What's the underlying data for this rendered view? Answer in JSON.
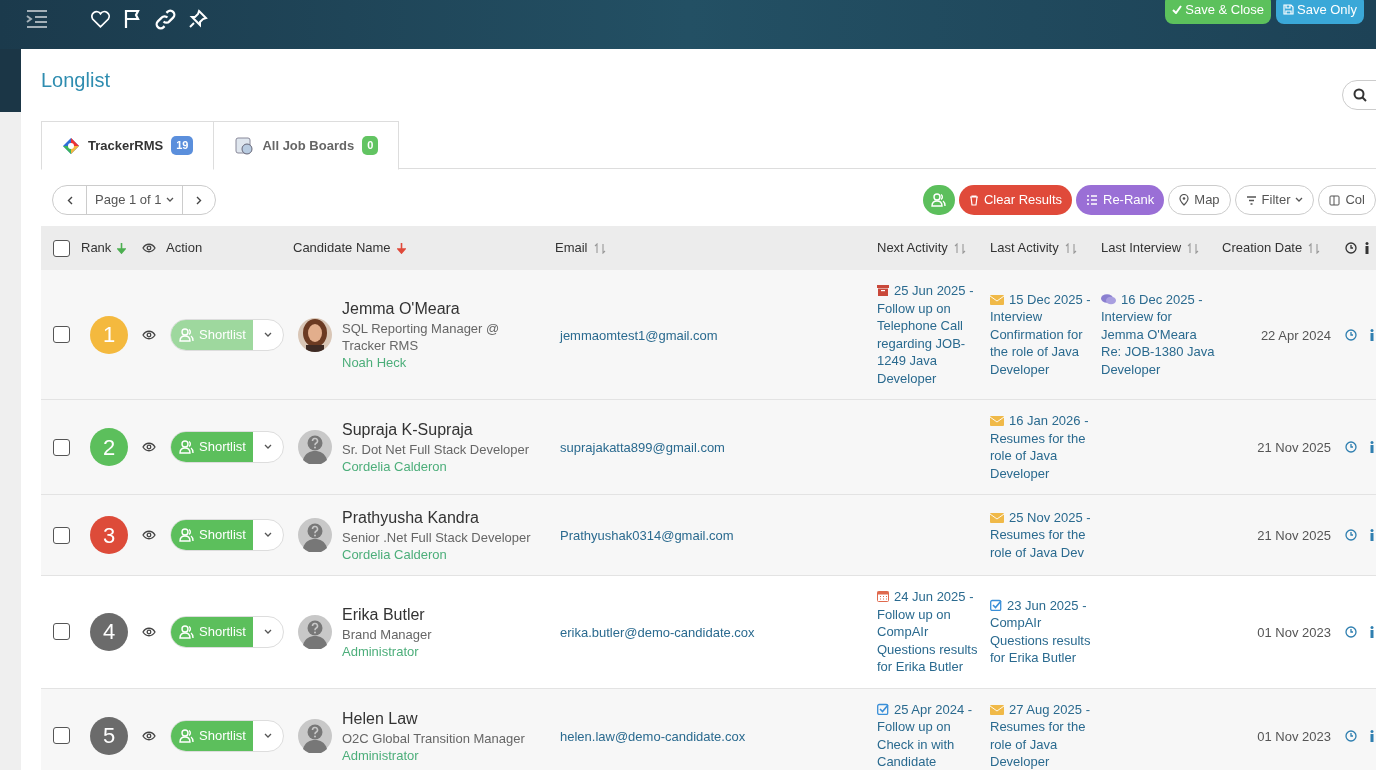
{
  "header": {
    "buttons": [
      {
        "kind": "save-close",
        "label": "Save & Close"
      },
      {
        "kind": "save",
        "label": "Save Only"
      }
    ]
  },
  "page_title": "Longlist",
  "tabs": [
    {
      "label": "TrackerRMS",
      "count": "19",
      "selected": true
    },
    {
      "label": "All Job Boards",
      "count": "0",
      "selected": false
    }
  ],
  "pager": {
    "label": "Page 1 of 1"
  },
  "actions": [
    {
      "kind": "shortlist"
    },
    {
      "kind": "clear",
      "label": "Clear Results"
    },
    {
      "kind": "rerank",
      "label": "Re-Rank"
    },
    {
      "kind": "map",
      "label": "Map"
    },
    {
      "kind": "filter",
      "label": "Filter"
    },
    {
      "kind": "columns",
      "label": "Col"
    }
  ],
  "columns": [
    {
      "kind": "check",
      "checked": false
    },
    {
      "kind": "text",
      "label": "Rank",
      "sorted": true,
      "color": "#4caf50"
    },
    {
      "kind": "eye"
    },
    {
      "kind": "text",
      "label": "Action"
    },
    {
      "kind": "text",
      "label": "Candidate Name",
      "sorted": true,
      "color": "#e0493a"
    },
    {
      "kind": "text",
      "label": "Email",
      "sortable": true
    },
    {
      "kind": "text",
      "label": "Next Activity",
      "sortable": true
    },
    {
      "kind": "text",
      "label": "Last Activity",
      "sortable": true
    },
    {
      "kind": "text",
      "label": "Last Interview",
      "sortable": true
    },
    {
      "kind": "text",
      "label": "Creation Date",
      "sortable": true
    },
    {
      "kind": "clock"
    },
    {
      "kind": "info"
    }
  ],
  "rows": [
    {
      "checked": false,
      "rank": "1",
      "color": "#f4b93e",
      "shortlist": {
        "label": "Shortlist",
        "disabled": true
      },
      "photo": true,
      "name": "Jemma O'Meara",
      "title": "SQL Reporting Manager @ Tracker RMS",
      "owner": "Noah Heck",
      "email": "jemmaomtest1@gmail.com",
      "next_activity": {
        "kind": "task",
        "text": "25 Jun 2025 - Follow up on Telephone Call regarding JOB-1249 Java Developer"
      },
      "last_activity": {
        "kind": "mail",
        "text": "15 Dec 2025 - Interview Confirmation for the role of Java Developer"
      },
      "last_interview": {
        "kind": "chat",
        "text": "16 Dec 2025 - Interview for Jemma O'Meara Re: JOB-1380 Java Developer"
      },
      "created": "22 Apr 2024"
    },
    {
      "checked": false,
      "rank": "2",
      "color": "#5cbf5c",
      "shortlist": {
        "label": "Shortlist",
        "disabled": false
      },
      "photo": false,
      "name": "Supraja K-Supraja",
      "title": "Sr. Dot Net Full Stack Developer",
      "owner": "Cordelia Calderon",
      "email": "suprajakatta899@gmail.com",
      "last_activity": {
        "kind": "mail",
        "text": "16 Jan 2026 - Resumes for the role of Java Developer"
      },
      "created": "21 Nov 2025"
    },
    {
      "checked": false,
      "rank": "3",
      "color": "#dd4b39",
      "shortlist": {
        "label": "Shortlist",
        "disabled": false
      },
      "photo": false,
      "name": "Prathyusha Kandra",
      "title": "Senior .Net Full Stack Developer",
      "owner": "Cordelia Calderon",
      "email": "Prathyushak0314@gmail.com",
      "last_activity": {
        "kind": "mail",
        "text": "25 Nov 2025 - Resumes for the role of Java Dev"
      },
      "created": "21 Nov 2025"
    },
    {
      "checked": false,
      "rank": "4",
      "color": "#6b6b6b",
      "shortlist": {
        "label": "Shortlist",
        "disabled": false
      },
      "photo": false,
      "name": "Erika Butler",
      "title": "Brand Manager",
      "owner": "Administrator",
      "email": "erika.butler@demo-candidate.cox",
      "next_activity": {
        "kind": "calendar",
        "text": "24 Jun 2025 - Follow up on CompAIr Questions results for Erika Butler"
      },
      "last_activity": {
        "kind": "check",
        "text": "23 Jun 2025 - CompAIr Questions results for Erika Butler"
      },
      "created": "01 Nov 2023"
    },
    {
      "checked": false,
      "rank": "5",
      "color": "#6b6b6b",
      "shortlist": {
        "label": "Shortlist",
        "disabled": false
      },
      "photo": false,
      "name": "Helen Law",
      "title": "O2C Global Transition Manager",
      "owner": "Administrator",
      "email": "helen.law@demo-candidate.cox",
      "next_activity": {
        "kind": "check",
        "text": "25 Apr 2024 - Follow up on Check in with Candidate"
      },
      "last_activity": {
        "kind": "mail",
        "text": "27 Aug 2025 - Resumes for the role of Java Developer"
      },
      "created": "01 Nov 2023"
    }
  ]
}
